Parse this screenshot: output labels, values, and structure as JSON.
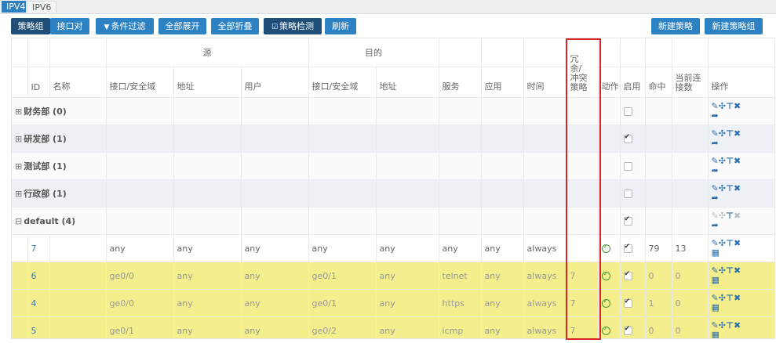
{
  "tabs": [
    {
      "label": "IPV4",
      "active": true
    },
    {
      "label": "IPV6",
      "active": false
    }
  ],
  "toolbar": {
    "policy_group": "策略组",
    "interface_pair": "接口对",
    "filter": "条件过滤",
    "expand_all": "全部展开",
    "collapse_all": "全部折叠",
    "policy_check": "策略检测",
    "refresh": "刷新",
    "new_policy": "新建策略",
    "new_policy_group": "新建策略组"
  },
  "columns": {
    "source_group": "源",
    "dest_group": "目的",
    "redundant": "冗\n余/\n冲突\n策略",
    "id": "ID",
    "name": "名称",
    "src_if": "接口/安全域",
    "src_addr": "地址",
    "src_user": "用户",
    "dst_if": "接口/安全域",
    "dst_addr": "地址",
    "service": "服务",
    "app": "应用",
    "time": "时间",
    "action": "动作",
    "enable": "启用",
    "hits": "命中",
    "conns": "当前连接数",
    "ops": "操作"
  },
  "groups": [
    {
      "label": "财务部 (0)",
      "enabled": false
    },
    {
      "label": "研发部 (1)",
      "enabled": true
    },
    {
      "label": "测试部 (1)",
      "enabled": false
    },
    {
      "label": "行政部 (1)",
      "enabled": false
    },
    {
      "label": "default (4)",
      "enabled": true
    }
  ],
  "rules": [
    {
      "id": "7",
      "name": "",
      "src_if": "any",
      "src_addr": "any",
      "src_user": "any",
      "dst_if": "any",
      "dst_addr": "any",
      "service": "any",
      "app": "any",
      "time": "always",
      "redundant": "",
      "enabled": true,
      "hits": "79",
      "conns": "13",
      "highlight": false
    },
    {
      "id": "6",
      "name": "",
      "src_if": "ge0/0",
      "src_addr": "any",
      "src_user": "any",
      "dst_if": "ge0/1",
      "dst_addr": "any",
      "service": "telnet",
      "app": "any",
      "time": "always",
      "redundant": "7",
      "enabled": true,
      "hits": "0",
      "conns": "0",
      "highlight": true
    },
    {
      "id": "4",
      "name": "",
      "src_if": "ge0/0",
      "src_addr": "any",
      "src_user": "any",
      "dst_if": "ge0/1",
      "dst_addr": "any",
      "service": "https",
      "app": "any",
      "time": "always",
      "redundant": "7",
      "enabled": true,
      "hits": "1",
      "conns": "0",
      "highlight": true
    },
    {
      "id": "5",
      "name": "",
      "src_if": "ge0/1",
      "src_addr": "any",
      "src_user": "any",
      "dst_if": "ge0/2",
      "dst_addr": "any",
      "service": "icmp",
      "app": "any",
      "time": "always",
      "redundant": "7",
      "enabled": true,
      "hits": "0",
      "conns": "0",
      "highlight": true
    }
  ],
  "icons": {
    "edit": "pencil-icon",
    "move": "move-icon",
    "pin": "pin-icon",
    "delete": "delete-icon",
    "share": "forward-icon",
    "grid": "grid-icon"
  }
}
